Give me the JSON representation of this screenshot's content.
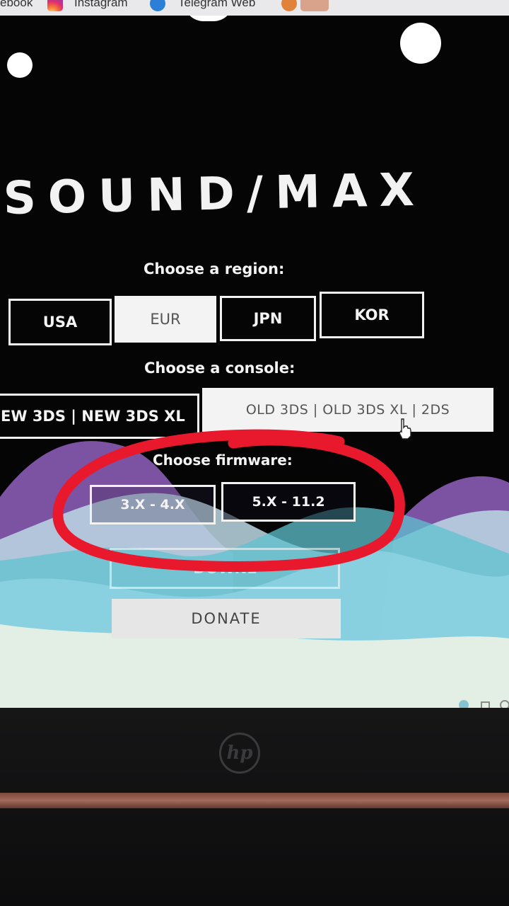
{
  "browser": {
    "bookmarks": [
      {
        "label": "ebook"
      },
      {
        "label": "Instagram"
      },
      {
        "label": "Telegram Web"
      }
    ]
  },
  "app": {
    "logo_text": "SOUND/MAX"
  },
  "region": {
    "label": "Choose a region:",
    "options": [
      "USA",
      "EUR",
      "JPN",
      "KOR"
    ],
    "selected": "EUR"
  },
  "console": {
    "label": "Choose a console:",
    "options": [
      "EW 3DS | NEW 3DS XL",
      "OLD 3DS | OLD 3DS XL | 2DS"
    ],
    "selected": "OLD 3DS | OLD 3DS XL | 2DS"
  },
  "firmware": {
    "label": "Choose firmware:",
    "options": [
      "3.X - 4.X",
      "5.X - 11.2"
    ]
  },
  "actions": {
    "download_label": "DOWNL",
    "donate_label": "DONATE"
  },
  "device": {
    "brand_logo": "hp"
  },
  "colors": {
    "annotation_red": "#e8192c",
    "wave_purple": "#8a5bb4",
    "wave_teal": "#5fc2cf"
  }
}
